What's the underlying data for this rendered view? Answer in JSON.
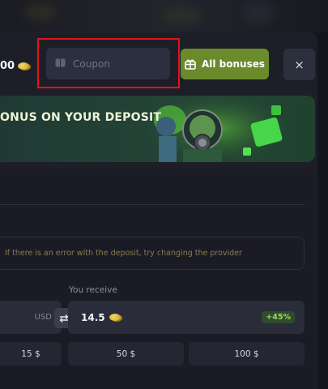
{
  "header": {
    "balance_text": "00",
    "coupon": {
      "placeholder": "Coupon",
      "value": ""
    },
    "bonus_button_label": "All bonuses",
    "close_label": "×"
  },
  "banner": {
    "title": "ONUS ON YOUR DEPOSIT"
  },
  "deposit": {
    "notice": "If there is an error with the deposit, try changing the provider",
    "receive_label": "You receive",
    "currency": "USD",
    "receive_value": "14.5",
    "bonus_percent": "+45%",
    "amounts": [
      "15 $",
      "50 $",
      "100 $"
    ]
  },
  "colors": {
    "accent_green": "#6b8a2c",
    "highlight_red": "#e0141b",
    "panel_bg": "#1d1e27"
  }
}
